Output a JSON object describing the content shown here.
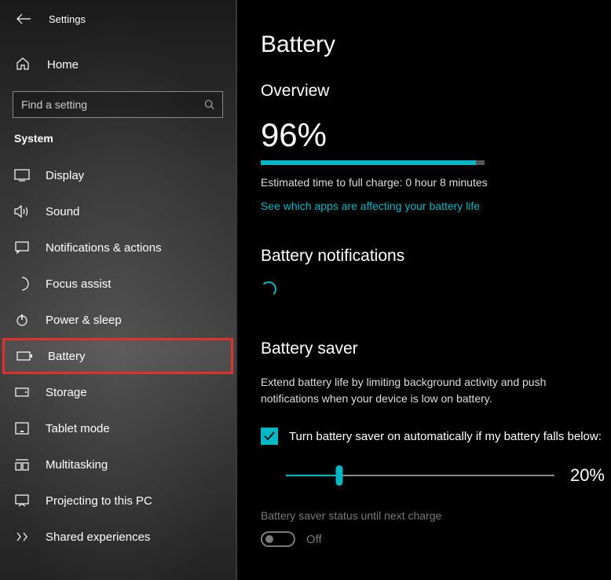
{
  "header": {
    "app_name": "Settings",
    "home_label": "Home",
    "section_label": "System"
  },
  "search": {
    "placeholder": "Find a setting"
  },
  "sidebar": {
    "items": [
      {
        "label": "Display",
        "icon": "display"
      },
      {
        "label": "Sound",
        "icon": "sound"
      },
      {
        "label": "Notifications & actions",
        "icon": "notifications"
      },
      {
        "label": "Focus assist",
        "icon": "focus"
      },
      {
        "label": "Power & sleep",
        "icon": "power"
      },
      {
        "label": "Battery",
        "icon": "battery"
      },
      {
        "label": "Storage",
        "icon": "storage"
      },
      {
        "label": "Tablet mode",
        "icon": "tablet"
      },
      {
        "label": "Multitasking",
        "icon": "multitasking"
      },
      {
        "label": "Projecting to this PC",
        "icon": "projecting"
      },
      {
        "label": "Shared experiences",
        "icon": "shared"
      }
    ]
  },
  "main": {
    "page_title": "Battery",
    "overview_title": "Overview",
    "percent": "96%",
    "percent_value": 96,
    "estimate_text": "Estimated time to full charge: 0 hour 8 minutes",
    "apps_link": "See which apps are affecting your battery life",
    "notifications_title": "Battery notifications",
    "saver_title": "Battery saver",
    "saver_desc": "Extend battery life by limiting background activity and push notifications when your device is low on battery.",
    "saver_checkbox_label": "Turn battery saver on automatically if my battery falls below:",
    "saver_checked": true,
    "slider_value": 20,
    "slider_label": "20%",
    "status_label": "Battery saver status until next charge",
    "toggle_state": "Off"
  }
}
